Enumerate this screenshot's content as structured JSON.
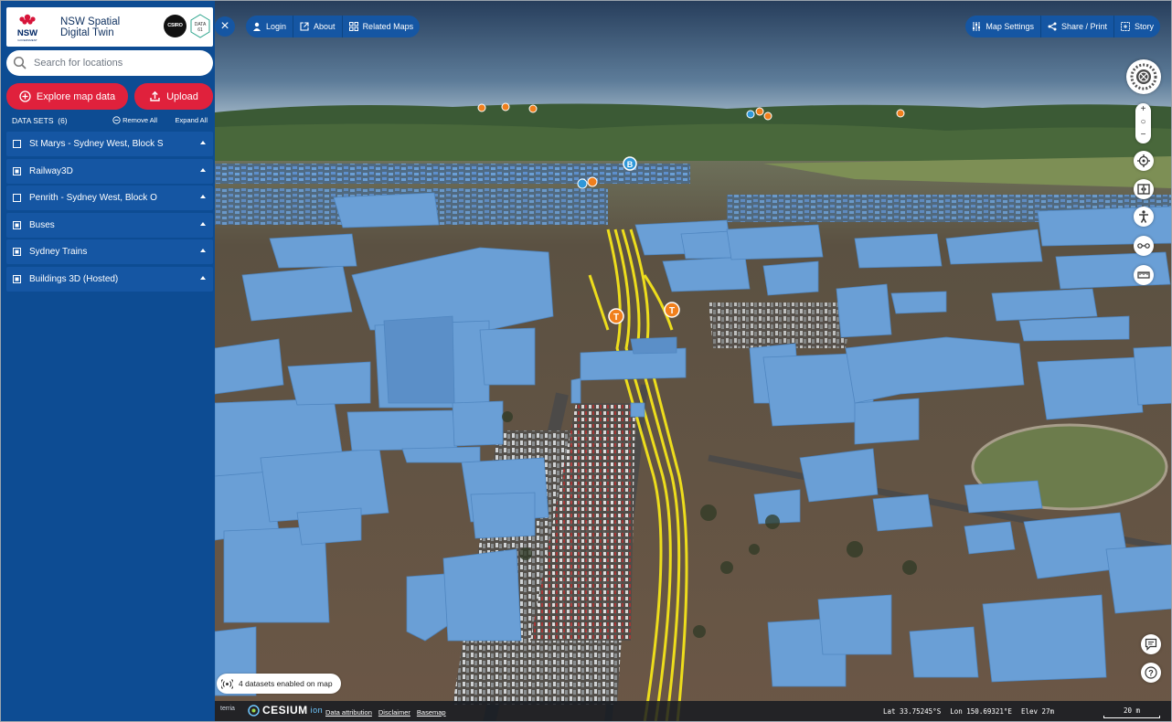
{
  "brand": {
    "logo_text": "NSW",
    "title": "NSW Spatial Digital Twin",
    "partner_1": "CSIRO",
    "partner_2": "DATA61"
  },
  "search": {
    "placeholder": "Search for locations"
  },
  "actions": {
    "explore_label": "Explore map data",
    "upload_label": "Upload"
  },
  "datasets": {
    "heading": "DATA SETS",
    "count": "(6)",
    "remove_all": "Remove All",
    "expand_all": "Expand All",
    "items": [
      {
        "label": "St Marys - Sydney West, Block S",
        "enabled": false
      },
      {
        "label": "Railway3D",
        "enabled": true
      },
      {
        "label": "Penrith - Sydney West, Block O",
        "enabled": false
      },
      {
        "label": "Buses",
        "enabled": true
      },
      {
        "label": "Sydney Trains",
        "enabled": true
      },
      {
        "label": "Buildings 3D (Hosted)",
        "enabled": true
      }
    ]
  },
  "toolbar_left": {
    "login": "Login",
    "about": "About",
    "related_maps": "Related Maps"
  },
  "toolbar_right": {
    "map_settings": "Map Settings",
    "share_print": "Share / Print",
    "story": "Story"
  },
  "map": {
    "datasets_enabled": "4 datasets enabled on map",
    "markers": {
      "train": "T",
      "bus": "B"
    },
    "colors": {
      "buildings": "#6a9fd6",
      "railway": "#f5e51a",
      "markers": "#f07f1d",
      "bus_marker": "#2f97d8"
    }
  },
  "zoom": {
    "in": "+",
    "reset": "○",
    "out": "−"
  },
  "footer": {
    "terria": "terria",
    "cesium": "CESIUM",
    "cesium_ion": "ion",
    "links": [
      "Data attribution",
      "Disclaimer",
      "Basemap"
    ],
    "lat": "Lat  33.75245°S",
    "lon": "Lon 150.69321°E",
    "elev": "Elev  27m",
    "scale": "20 m"
  }
}
